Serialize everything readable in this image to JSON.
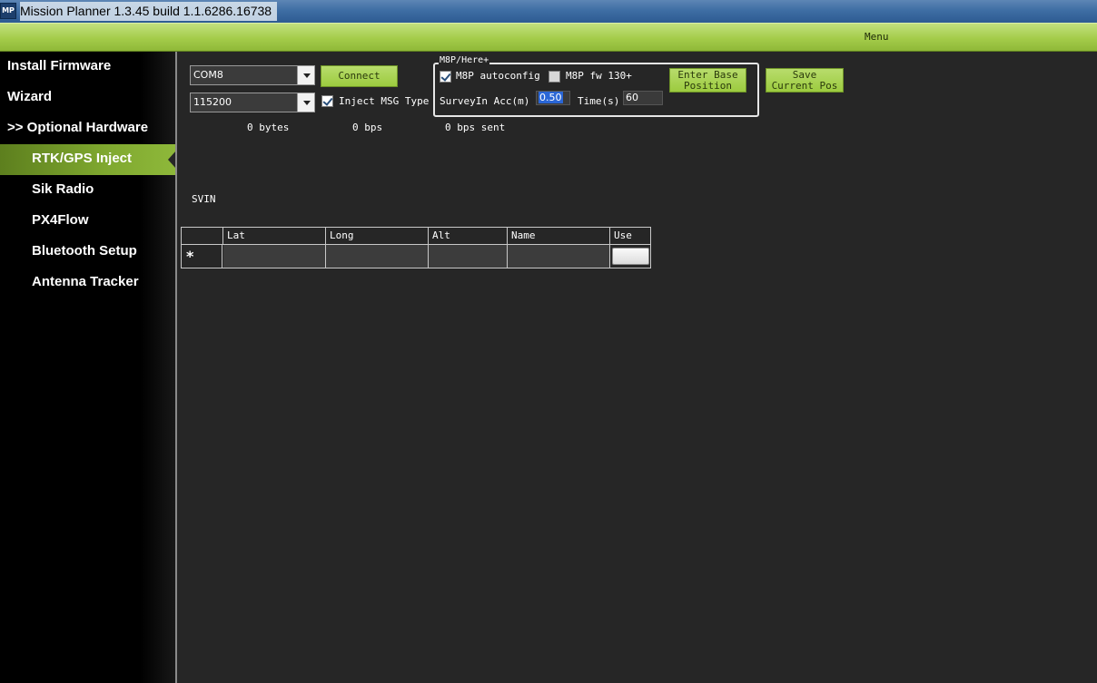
{
  "window": {
    "icon_text": "MP",
    "title": "Mission Planner 1.3.45 build 1.1.6286.16738"
  },
  "menubar": {
    "menu_label": "Menu"
  },
  "sidebar": {
    "items": [
      {
        "label": "Install Firmware"
      },
      {
        "label": "Wizard"
      },
      {
        "label": ">> Optional Hardware"
      },
      {
        "label": "RTK/GPS Inject"
      },
      {
        "label": "Sik Radio"
      },
      {
        "label": "PX4Flow"
      },
      {
        "label": "Bluetooth Setup"
      },
      {
        "label": "Antenna Tracker"
      }
    ]
  },
  "inject": {
    "port_value": "COM8",
    "baud_value": "115200",
    "connect_label": "Connect",
    "inject_msg_label": "Inject MSG Type",
    "bytes_status": "0 bytes",
    "bps_status": "0 bps",
    "bps_sent_status": "0 bps sent",
    "svin_label": "SVIN"
  },
  "m8p": {
    "group_title": "M8P/Here+",
    "autoconfig_label": "M8P autoconfig",
    "fw130_label": "M8P fw 130+",
    "surveyin_label": "SurveyIn Acc(m)",
    "surveyin_value": "0.50",
    "time_label": "Time(s)",
    "time_value": "60",
    "enter_base_line1": "Enter Base",
    "enter_base_line2": "Position",
    "save_pos_line1": "Save",
    "save_pos_line2": "Current Pos"
  },
  "grid": {
    "columns": [
      "Lat",
      "Long",
      "Alt",
      "Name",
      "Use"
    ],
    "new_row_marker": "*"
  }
}
